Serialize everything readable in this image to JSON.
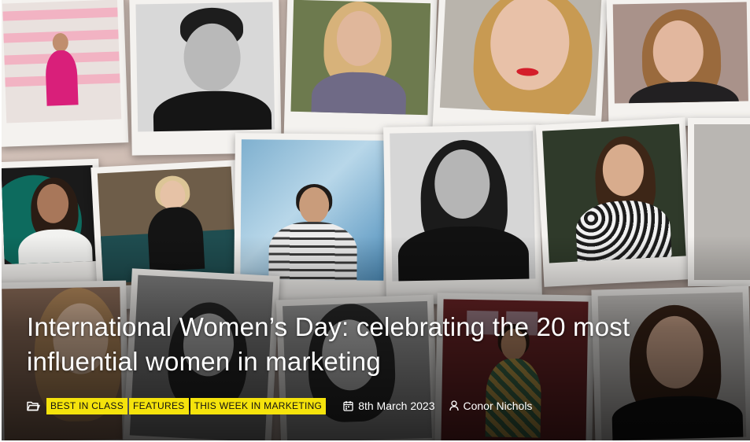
{
  "article": {
    "title": "International Women’s Day: celebrating the 20 most influential women in marketing",
    "categories": [
      "BEST IN CLASS",
      "FEATURES",
      "THIS WEEK IN MARKETING"
    ],
    "date": "8th March 2023",
    "author": "Conor Nichols"
  },
  "icons": {
    "category": "folder-icon",
    "date": "calendar-icon",
    "author": "user-icon"
  },
  "colors": {
    "tag_background": "#f5e30c",
    "tag_text": "#111111",
    "headline": "#ffffff"
  }
}
